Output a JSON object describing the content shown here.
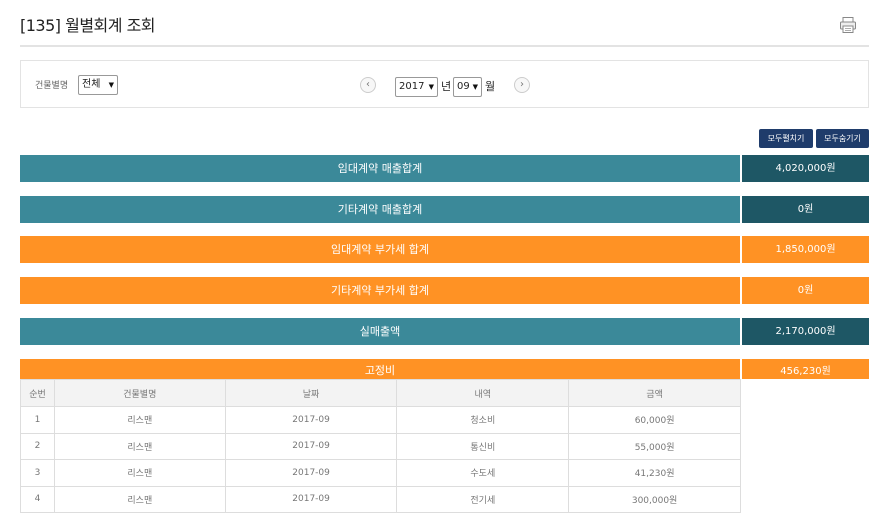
{
  "header": {
    "title": "[135] 월별회계 조회"
  },
  "filter": {
    "building_label": "건물별명",
    "building_value": "전체",
    "year_value": "2017",
    "year_unit": "년",
    "month_value": "09",
    "month_unit": "월",
    "prev_symbol": "‹",
    "next_symbol": "›"
  },
  "buttons": {
    "expand_all": "모두펼치기",
    "collapse_all": "모두숨기기"
  },
  "summary": [
    {
      "label": "임대계약 매출합계",
      "value": "4,020,000원",
      "style": "teal"
    },
    {
      "label": "기타계약 매출합계",
      "value": "0원",
      "style": "teal"
    },
    {
      "label": "임대계약 부가세 합계",
      "value": "1,850,000원",
      "style": "orange"
    },
    {
      "label": "기타계약 부가세 합계",
      "value": "0원",
      "style": "orange"
    },
    {
      "label": "실매출액",
      "value": "2,170,000원",
      "style": "teal"
    }
  ],
  "fixed_cost": {
    "label": "고정비",
    "value": "456,230원"
  },
  "table": {
    "headers": [
      "순번",
      "건물별명",
      "날짜",
      "내역",
      "금액"
    ],
    "rows": [
      [
        "1",
        "리스맨",
        "2017-09",
        "청소비",
        "60,000원"
      ],
      [
        "2",
        "리스맨",
        "2017-09",
        "통신비",
        "55,000원"
      ],
      [
        "3",
        "리스맨",
        "2017-09",
        "수도세",
        "41,230원"
      ],
      [
        "4",
        "리스맨",
        "2017-09",
        "전기세",
        "300,000원"
      ]
    ]
  },
  "colors": {
    "teal": "#3b8999",
    "teal_dark": "#1e5765",
    "orange": "#ff9224",
    "navy": "#1f3c6b"
  },
  "icons": {
    "print": "print-icon"
  }
}
